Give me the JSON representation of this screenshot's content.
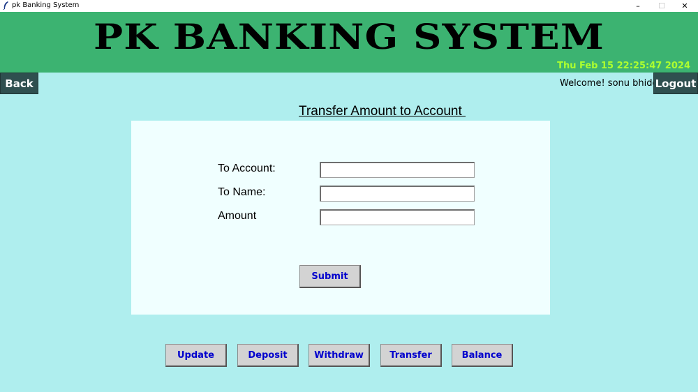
{
  "window": {
    "title": "pk Banking System",
    "minimize_glyph": "–",
    "maximize_glyph": "☐",
    "close_glyph": "✕",
    "icon": "feather-icon"
  },
  "header": {
    "brand": "PK BANKING SYSTEM",
    "datetime": "Thu Feb 15 22:25:47 2024",
    "background_color": "#3cb371",
    "datetime_color": "#adff2f"
  },
  "nav": {
    "back_label": "Back",
    "logout_label": "Logout",
    "welcome_text": "Welcome! sonu bhidd"
  },
  "form": {
    "title": "Transfer Amount to Account ",
    "fields": [
      {
        "label": "To Account:",
        "value": ""
      },
      {
        "label": "To Name:",
        "value": ""
      },
      {
        "label": "Amount",
        "value": ""
      }
    ],
    "submit_label": "Submit"
  },
  "actions": [
    {
      "label": "Update"
    },
    {
      "label": "Deposit"
    },
    {
      "label": "Withdraw"
    },
    {
      "label": "Transfer"
    },
    {
      "label": "Balance"
    }
  ],
  "colors": {
    "page_background": "#afeeee",
    "panel_background": "#f0ffff",
    "nav_button": "#2f4f4f",
    "action_button_text": "#0000cd"
  }
}
